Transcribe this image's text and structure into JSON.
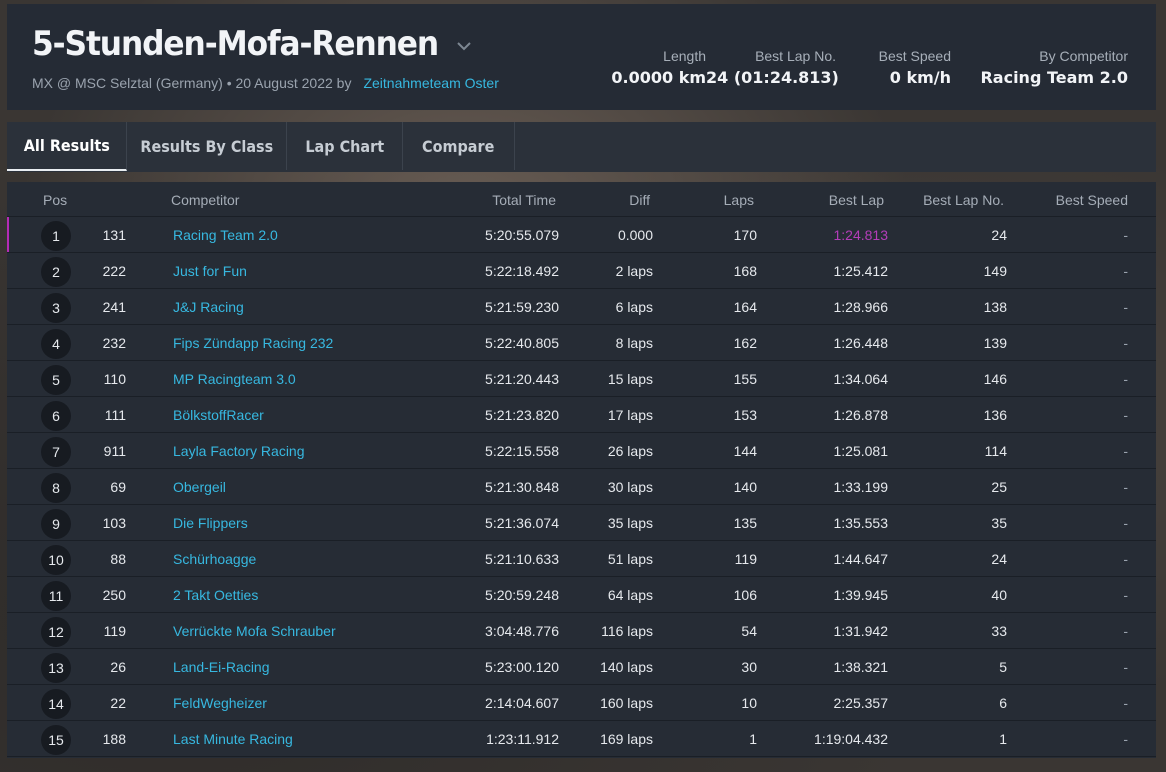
{
  "event": {
    "title": "5-Stunden-Mofa-Rennen",
    "subtitle": "MX @ MSC Selztal (Germany) • 20 August 2022 by",
    "organizer": "Zeitnahmeteam Oster"
  },
  "stats": [
    {
      "label": "Length",
      "value": "0.0000 km"
    },
    {
      "label": "Best Lap No.",
      "value": "24 (01:24.813)"
    },
    {
      "label": "Best Speed",
      "value": "0 km/h"
    },
    {
      "label": "By Competitor",
      "value": "Racing Team 2.0"
    }
  ],
  "tabs": [
    "All Results",
    "Results By Class",
    "Lap Chart",
    "Compare"
  ],
  "columns": {
    "pos": "Pos",
    "competitor": "Competitor",
    "total_time": "Total Time",
    "diff": "Diff",
    "laps": "Laps",
    "best_lap": "Best Lap",
    "best_lap_no": "Best Lap No.",
    "best_speed": "Best Speed"
  },
  "rows": [
    {
      "pos": "1",
      "num": "131",
      "competitor": "Racing Team 2.0",
      "total": "5:20:55.079",
      "diff": "0.000",
      "laps": "170",
      "best": "1:24.813",
      "best_no": "24",
      "speed": "-"
    },
    {
      "pos": "2",
      "num": "222",
      "competitor": "Just for Fun",
      "total": "5:22:18.492",
      "diff": "2 laps",
      "laps": "168",
      "best": "1:25.412",
      "best_no": "149",
      "speed": "-"
    },
    {
      "pos": "3",
      "num": "241",
      "competitor": "J&J Racing",
      "total": "5:21:59.230",
      "diff": "6 laps",
      "laps": "164",
      "best": "1:28.966",
      "best_no": "138",
      "speed": "-"
    },
    {
      "pos": "4",
      "num": "232",
      "competitor": "Fips Zündapp Racing 232",
      "total": "5:22:40.805",
      "diff": "8 laps",
      "laps": "162",
      "best": "1:26.448",
      "best_no": "139",
      "speed": "-"
    },
    {
      "pos": "5",
      "num": "110",
      "competitor": "MP Racingteam 3.0",
      "total": "5:21:20.443",
      "diff": "15 laps",
      "laps": "155",
      "best": "1:34.064",
      "best_no": "146",
      "speed": "-"
    },
    {
      "pos": "6",
      "num": "111",
      "competitor": "BölkstoffRacer",
      "total": "5:21:23.820",
      "diff": "17 laps",
      "laps": "153",
      "best": "1:26.878",
      "best_no": "136",
      "speed": "-"
    },
    {
      "pos": "7",
      "num": "911",
      "competitor": "Layla Factory Racing",
      "total": "5:22:15.558",
      "diff": "26 laps",
      "laps": "144",
      "best": "1:25.081",
      "best_no": "114",
      "speed": "-"
    },
    {
      "pos": "8",
      "num": "69",
      "competitor": "Obergeil",
      "total": "5:21:30.848",
      "diff": "30 laps",
      "laps": "140",
      "best": "1:33.199",
      "best_no": "25",
      "speed": "-"
    },
    {
      "pos": "9",
      "num": "103",
      "competitor": "Die Flippers",
      "total": "5:21:36.074",
      "diff": "35 laps",
      "laps": "135",
      "best": "1:35.553",
      "best_no": "35",
      "speed": "-"
    },
    {
      "pos": "10",
      "num": "88",
      "competitor": "Schürhoagge",
      "total": "5:21:10.633",
      "diff": "51 laps",
      "laps": "119",
      "best": "1:44.647",
      "best_no": "24",
      "speed": "-"
    },
    {
      "pos": "11",
      "num": "250",
      "competitor": "2 Takt Oetties",
      "total": "5:20:59.248",
      "diff": "64 laps",
      "laps": "106",
      "best": "1:39.945",
      "best_no": "40",
      "speed": "-"
    },
    {
      "pos": "12",
      "num": "119",
      "competitor": "Verrückte Mofa Schrauber",
      "total": "3:04:48.776",
      "diff": "116 laps",
      "laps": "54",
      "best": "1:31.942",
      "best_no": "33",
      "speed": "-"
    },
    {
      "pos": "13",
      "num": "26",
      "competitor": "Land-Ei-Racing",
      "total": "5:23:00.120",
      "diff": "140 laps",
      "laps": "30",
      "best": "1:38.321",
      "best_no": "5",
      "speed": "-"
    },
    {
      "pos": "14",
      "num": "22",
      "competitor": "FeldWegheizer",
      "total": "2:14:04.607",
      "diff": "160 laps",
      "laps": "10",
      "best": "2:25.357",
      "best_no": "6",
      "speed": "-"
    },
    {
      "pos": "15",
      "num": "188",
      "competitor": "Last Minute Racing",
      "total": "1:23:11.912",
      "diff": "169 laps",
      "laps": "1",
      "best": "1:19:04.432",
      "best_no": "1",
      "speed": "-"
    }
  ],
  "colors": {
    "accent_link": "#37b8e0",
    "best_lap_highlight": "#b43db9"
  },
  "icons": {
    "title_dropdown": "chevron-down-icon"
  }
}
